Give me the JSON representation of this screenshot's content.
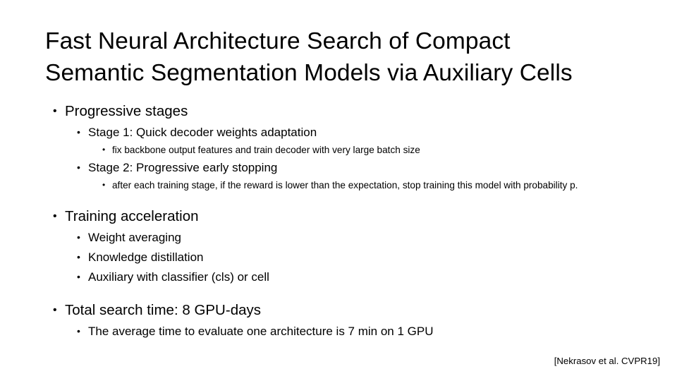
{
  "slide": {
    "background_color": "#ffffff",
    "text_color": "#000000",
    "title": {
      "line1": "Fast Neural Architecture Search of Compact",
      "line2": "Semantic Segmentation Models via Auxiliary Cells"
    },
    "bullet_glyph": "•",
    "content": [
      {
        "level": 1,
        "text": "Progressive stages"
      },
      {
        "level": 2,
        "text": "Stage 1: Quick decoder weights adaptation"
      },
      {
        "level": 3,
        "text": "fix backbone output features and train decoder with very large batch size"
      },
      {
        "level": 2,
        "text": "Stage 2: Progressive early stopping"
      },
      {
        "level": 3,
        "text": "after each training stage, if the reward is lower than the expectation, stop training this model with probability p."
      },
      {
        "level": 1,
        "text": "Training acceleration"
      },
      {
        "level": 2,
        "text": "Weight averaging"
      },
      {
        "level": 2,
        "text": "Knowledge distillation"
      },
      {
        "level": 2,
        "text": "Auxiliary with classifier (cls) or cell"
      },
      {
        "level": 1,
        "text": "Total search time: 8 GPU-days"
      },
      {
        "level": 2,
        "text": "The average time to evaluate one architecture is 7 min on 1 GPU"
      }
    ],
    "citation": "[Nekrasov et al. CVPR19]"
  }
}
